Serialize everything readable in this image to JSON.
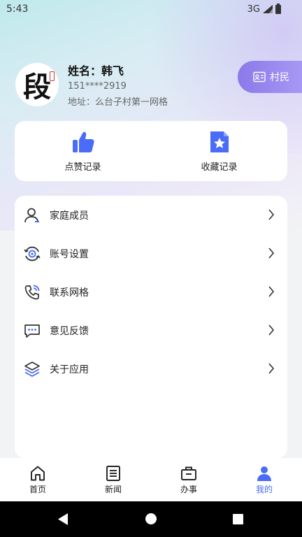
{
  "status_bar": {
    "time": "5:43",
    "network": "3G"
  },
  "profile": {
    "avatar_char": "段",
    "name": "姓名：韩飞",
    "phone": "151****2919",
    "address": "地址：么台子村第一网格"
  },
  "role_badge": {
    "label": "村民"
  },
  "quick_actions": [
    {
      "label": "点赞记录",
      "icon": "thumbs-up-icon"
    },
    {
      "label": "收藏记录",
      "icon": "star-document-icon"
    }
  ],
  "menu": [
    {
      "label": "家庭成员",
      "icon": "user-icon"
    },
    {
      "label": "账号设置",
      "icon": "account-settings-icon"
    },
    {
      "label": "联系网格",
      "icon": "phone-icon"
    },
    {
      "label": "意见反馈",
      "icon": "feedback-chat-icon"
    },
    {
      "label": "关于应用",
      "icon": "layers-icon"
    }
  ],
  "tabs": [
    {
      "label": "首页",
      "icon": "home-icon",
      "active": false
    },
    {
      "label": "新闻",
      "icon": "news-icon",
      "active": false
    },
    {
      "label": "办事",
      "icon": "briefcase-icon",
      "active": false
    },
    {
      "label": "我的",
      "icon": "person-icon",
      "active": true
    }
  ],
  "colors": {
    "accent": "#4a6cf7",
    "badge_start": "#8b79e9",
    "badge_end": "#a99af5"
  }
}
